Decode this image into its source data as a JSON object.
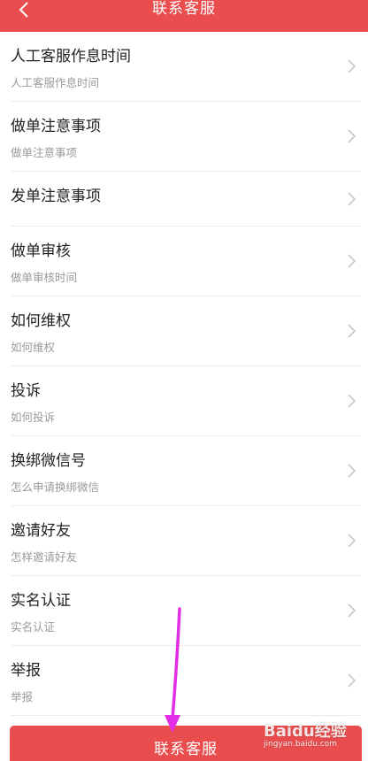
{
  "header": {
    "title": "联系客服",
    "back_icon": "chevron-left-icon"
  },
  "items": [
    {
      "label": "人工客服作息时间",
      "sub": "人工客服作息时间"
    },
    {
      "label": "做单注意事项",
      "sub": "做单注意事项"
    },
    {
      "label": "发单注意事项",
      "sub": ""
    },
    {
      "label": "做单审核",
      "sub": "做单审核时间"
    },
    {
      "label": "如何维权",
      "sub": "如何维权"
    },
    {
      "label": "投诉",
      "sub": "如何投诉"
    },
    {
      "label": "换绑微信号",
      "sub": "怎么申请换绑微信"
    },
    {
      "label": "邀请好友",
      "sub": "怎样邀请好友"
    },
    {
      "label": "实名认证",
      "sub": "实名认证"
    },
    {
      "label": "举报",
      "sub": "举报"
    }
  ],
  "bottom_button": {
    "label": "联系客服"
  },
  "watermark": {
    "main": "Baidu经验",
    "sub": "jingyan.baidu.com"
  },
  "colors": {
    "accent": "#ea4d4d",
    "annotation_arrow": "#e22ce6"
  }
}
